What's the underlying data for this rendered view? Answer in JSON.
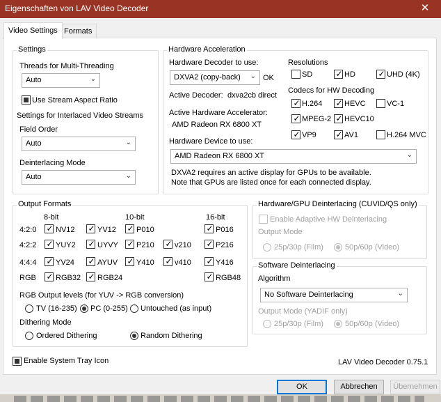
{
  "window": {
    "title": "Eigenschaften von LAV Video Decoder",
    "close_icon": "close-icon"
  },
  "tabs": [
    {
      "label": "Video Settings",
      "active": true
    },
    {
      "label": "Formats",
      "active": false
    }
  ],
  "settings": {
    "title": "Settings",
    "threads_label": "Threads for Multi-Threading",
    "threads_value": "Auto",
    "stream_aspect_label": "Use Stream Aspect Ratio",
    "interlaced_title": "Settings for Interlaced Video Streams",
    "field_order_label": "Field Order",
    "field_order_value": "Auto",
    "deinterlacing_mode_label": "Deinterlacing Mode",
    "deinterlacing_mode_value": "Auto"
  },
  "hwaccel": {
    "title": "Hardware Acceleration",
    "decoder_label": "Hardware Decoder to use:",
    "decoder_value": "DXVA2 (copy-back)",
    "decoder_status": "OK",
    "active_decoder_label": "Active Decoder:",
    "active_decoder_value": "dxva2cb direct",
    "active_accel_label": "Active Hardware Accelerator:",
    "active_accel_value": "AMD Radeon RX 6800 XT",
    "device_label": "Hardware Device to use:",
    "device_value": "AMD Radeon RX 6800 XT",
    "note_line1": "DXVA2 requires an active display for GPUs to be available.",
    "note_line2": "Note that GPUs are listed once for each connected display.",
    "resolutions_title": "Resolutions",
    "resolutions": [
      {
        "label": "SD",
        "checked": false
      },
      {
        "label": "HD",
        "checked": true
      },
      {
        "label": "UHD (4K)",
        "checked": true
      }
    ],
    "codecs_title": "Codecs for HW Decoding",
    "codecs": [
      {
        "label": "H.264",
        "checked": true
      },
      {
        "label": "HEVC",
        "checked": true
      },
      {
        "label": "VC-1",
        "checked": false
      },
      {
        "label": "MPEG-2",
        "checked": true
      },
      {
        "label": "HEVC10",
        "checked": true
      },
      {
        "label": "VP9",
        "checked": true
      },
      {
        "label": "AV1",
        "checked": true
      },
      {
        "label": "H.264 MVC",
        "checked": false
      }
    ]
  },
  "output": {
    "title": "Output Formats",
    "headers": {
      "b8": "8-bit",
      "b10": "10-bit",
      "b16": "16-bit"
    },
    "rows": [
      {
        "label": "4:2:0",
        "items": [
          {
            "label": "NV12",
            "checked": true
          },
          {
            "label": "YV12",
            "checked": true
          },
          {
            "label": "P010",
            "checked": true
          },
          {
            "label": "P016",
            "checked": true
          }
        ]
      },
      {
        "label": "4:2:2",
        "items": [
          {
            "label": "YUY2",
            "checked": true
          },
          {
            "label": "UYVY",
            "checked": true
          },
          {
            "label": "P210",
            "checked": true
          },
          {
            "label": "v210",
            "checked": true
          },
          {
            "label": "P216",
            "checked": true
          }
        ]
      },
      {
        "label": "4:4:4",
        "items": [
          {
            "label": "YV24",
            "checked": true
          },
          {
            "label": "AYUV",
            "checked": true
          },
          {
            "label": "Y410",
            "checked": true
          },
          {
            "label": "v410",
            "checked": true
          },
          {
            "label": "Y416",
            "checked": true
          }
        ]
      },
      {
        "label": "RGB",
        "items": [
          {
            "label": "RGB32",
            "checked": true
          },
          {
            "label": "RGB24",
            "checked": true
          },
          {
            "label": "RGB48",
            "checked": true
          }
        ]
      }
    ],
    "rgb_levels_label": "RGB Output levels (for YUV -> RGB conversion)",
    "rgb_levels": [
      {
        "label": "TV (16-235)",
        "selected": false
      },
      {
        "label": "PC (0-255)",
        "selected": true
      },
      {
        "label": "Untouched (as input)",
        "selected": false
      }
    ],
    "dithering_label": "Dithering Mode",
    "dithering": [
      {
        "label": "Ordered Dithering",
        "selected": false
      },
      {
        "label": "Random Dithering",
        "selected": true
      }
    ]
  },
  "hw_deint": {
    "title": "Hardware/GPU Deinterlacing (CUVID/QS only)",
    "adaptive_label": "Enable Adaptive HW Deinterlacing",
    "output_mode_label": "Output Mode",
    "options": [
      {
        "label": "25p/30p (Film)",
        "selected": false
      },
      {
        "label": "50p/60p (Video)",
        "selected": true
      }
    ]
  },
  "sw_deint": {
    "title": "Software Deinterlacing",
    "algorithm_label": "Algorithm",
    "algorithm_value": "No Software Deinterlacing",
    "output_mode_label": "Output Mode (YADIF only)",
    "options": [
      {
        "label": "25p/30p (Film)",
        "selected": false
      },
      {
        "label": "50p/60p (Video)",
        "selected": true
      }
    ]
  },
  "tray_label": "Enable System Tray Icon",
  "version": "LAV Video Decoder 0.75.1",
  "buttons": {
    "ok": "OK",
    "cancel": "Abbrechen",
    "apply": "Übernehmen"
  }
}
